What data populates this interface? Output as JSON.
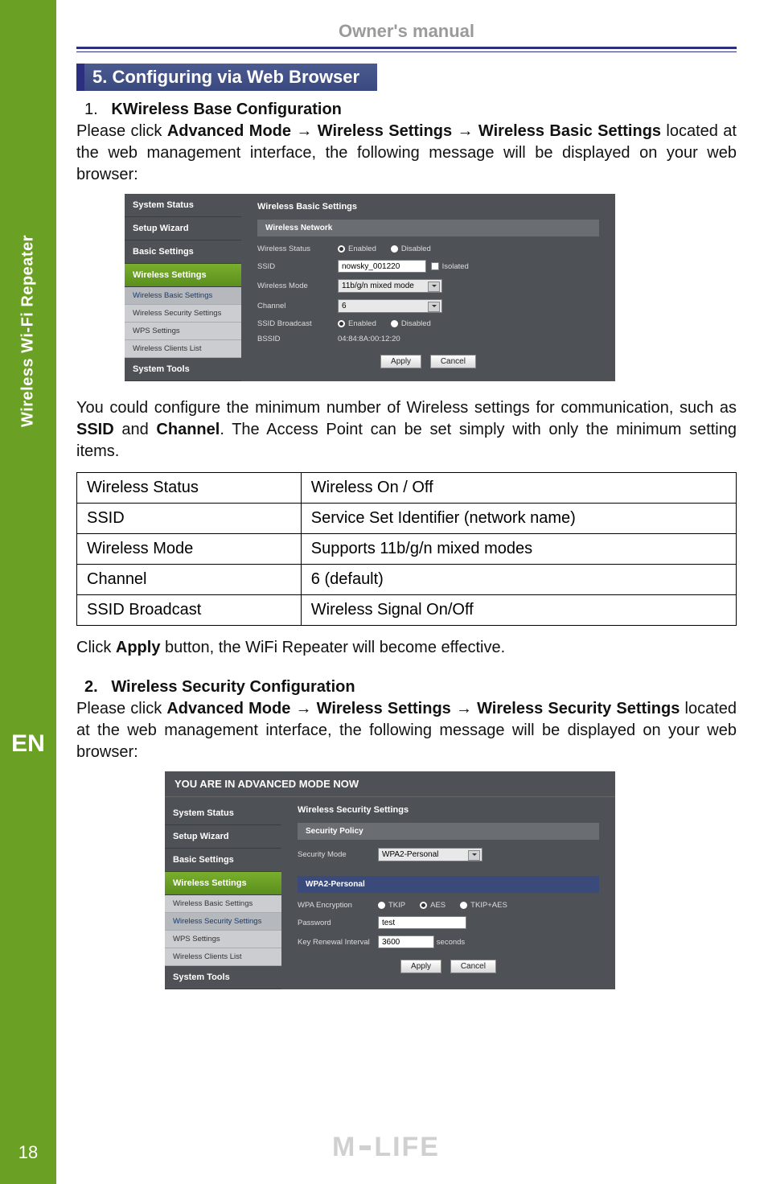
{
  "rail": {
    "vertical_label": "Wireless Wi-Fi Repeater",
    "lang": "EN",
    "page_number": "18"
  },
  "header": {
    "title": "Owner's manual"
  },
  "tab": {
    "label": "5. Configuring via Web Browser"
  },
  "sec1": {
    "num": "1.",
    "title": "KWireless Base Configuration",
    "path_pre": "Please click ",
    "path_bold": "Advanced Mode → Wireless Settings → Wireless Basic Settings",
    "path_post": " located at the web management interface, the following message will be displayed on your web browser:",
    "para2_a": "You could configure the minimum number of Wireless settings for communication, such as ",
    "para2_b1": "SSID",
    "para2_mid": " and ",
    "para2_b2": "Channel",
    "para2_c": ". The Access Point can be set simply with only the minimum setting items.",
    "apply_a": "Click ",
    "apply_b": "Apply",
    "apply_c": " button, the WiFi Repeater will become effective."
  },
  "router1": {
    "nav": [
      "System Status",
      "Setup Wizard",
      "Basic Settings",
      "Wireless Settings",
      "System Tools"
    ],
    "sub": [
      "Wireless Basic Settings",
      "Wireless Security Settings",
      "WPS Settings",
      "Wireless Clients List"
    ],
    "title": "Wireless Basic Settings",
    "panel": "Wireless Network",
    "rows": {
      "wireless_status": "Wireless Status",
      "ssid": "SSID",
      "wireless_mode": "Wireless Mode",
      "channel": "Channel",
      "ssid_broadcast": "SSID Broadcast",
      "bssid": "BSSID"
    },
    "vals": {
      "enabled": "Enabled",
      "disabled": "Disabled",
      "ssid_val": "nowsky_001220",
      "isolated": "Isolated",
      "mode_val": "11b/g/n mixed mode",
      "channel_val": "6",
      "bssid_val": "04:84:8A:00:12:20"
    },
    "buttons": {
      "apply": "Apply",
      "cancel": "Cancel"
    }
  },
  "table": {
    "r1": {
      "k": "Wireless Status",
      "v": " Wireless On / Off"
    },
    "r2": {
      "k": "SSID",
      "v": "Service Set Identifier (network name)"
    },
    "r3": {
      "k": "Wireless Mode",
      "v": "Supports 11b/g/n mixed modes"
    },
    "r4": {
      "k": "Channel",
      "v": " 6 (default)"
    },
    "r5": {
      "k": "SSID Broadcast",
      "v": "Wireless Signal On/Off"
    }
  },
  "sec2": {
    "num": "2.",
    "title": "Wireless Security Configuration",
    "path_pre": "Please click ",
    "path_bold": "Advanced Mode → Wireless Settings → Wireless Security Settings",
    "path_post": " located at the web management interface, the following message will be displayed on your web browser:"
  },
  "router2": {
    "banner": "YOU ARE IN ADVANCED MODE NOW",
    "title": "Wireless Security Settings",
    "panel1": "Security Policy",
    "panel2": "WPA2-Personal",
    "rows": {
      "security_mode": "Security Mode",
      "wpa_encryption": "WPA Encryption",
      "password": "Password",
      "key_renewal": "Key Renewal Interval"
    },
    "vals": {
      "mode_val": "WPA2-Personal",
      "tkip": "TKIP",
      "aes": "AES",
      "tkip_aes": "TKIP+AES",
      "password_val": "test",
      "interval_val": "3600",
      "seconds": "seconds"
    }
  },
  "footer": {
    "brand_m": "M",
    "brand_life": "LIFE"
  }
}
